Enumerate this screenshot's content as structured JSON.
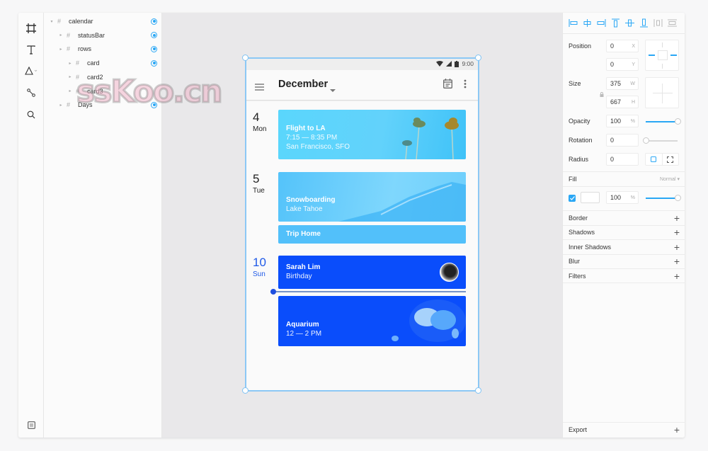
{
  "layers": [
    {
      "name": "calendar",
      "level": 0,
      "expanded": true,
      "visible": true
    },
    {
      "name": "statusBar",
      "level": 1,
      "expanded": false,
      "visible": true
    },
    {
      "name": "rows",
      "level": 1,
      "expanded": false,
      "visible": true
    },
    {
      "name": "card",
      "level": 2,
      "expanded": false,
      "visible": true
    },
    {
      "name": "card2",
      "level": 2,
      "expanded": false,
      "visible": false
    },
    {
      "name": "card3",
      "level": 2,
      "expanded": false,
      "visible": false
    },
    {
      "name": "Days",
      "level": 1,
      "expanded": false,
      "visible": true
    }
  ],
  "tools": [
    "artboard-icon",
    "text-icon",
    "shape-icon",
    "path-icon",
    "search-icon"
  ],
  "watermark": "ssKoo.cn",
  "phone": {
    "status": {
      "time": "9:00"
    },
    "header": {
      "month": "December"
    },
    "days": [
      {
        "num": "4",
        "dow": "Mon",
        "today": false
      },
      {
        "num": "5",
        "dow": "Tue",
        "today": false
      },
      {
        "num": "10",
        "dow": "Sun",
        "today": true
      }
    ],
    "events": [
      {
        "title": "Flight to LA",
        "lines": [
          "7:15 — 8:35 PM",
          "San Francisco, SFO"
        ],
        "color": "#5ad0fb"
      },
      {
        "title": "Snowboarding",
        "lines": [
          "Lake Tahoe"
        ],
        "color": "#56c3fa"
      },
      {
        "title": "Trip Home",
        "lines": [],
        "color": "#52c0fa"
      },
      {
        "title": "Sarah Lim",
        "lines": [
          "Birthday"
        ],
        "color": "#0a4dfb"
      },
      {
        "title": "Aquarium",
        "lines": [
          "12 — 2 PM"
        ],
        "color": "#0a4dfb"
      }
    ]
  },
  "props": {
    "position": {
      "label": "Position",
      "x": "0",
      "y": "0",
      "x_unit": "X",
      "y_unit": "Y"
    },
    "size": {
      "label": "Size",
      "w": "375",
      "h": "667",
      "w_unit": "W",
      "h_unit": "H"
    },
    "opacity": {
      "label": "Opacity",
      "value": "100",
      "unit": "%",
      "level": 1.0
    },
    "rotation": {
      "label": "Rotation",
      "value": "0",
      "level": 0.0
    },
    "radius": {
      "label": "Radius",
      "value": "0"
    },
    "fill": {
      "label": "Fill",
      "blend": "Normal",
      "enabled": true,
      "opacity": "100",
      "unit": "%",
      "level": 1.0,
      "color": "#ffffff"
    },
    "sections": [
      "Border",
      "Shadows",
      "Inner Shadows",
      "Blur",
      "Filters"
    ],
    "export": "Export"
  },
  "colors": {
    "accent": "#2aa7f5",
    "today": "#1f5ae8"
  }
}
